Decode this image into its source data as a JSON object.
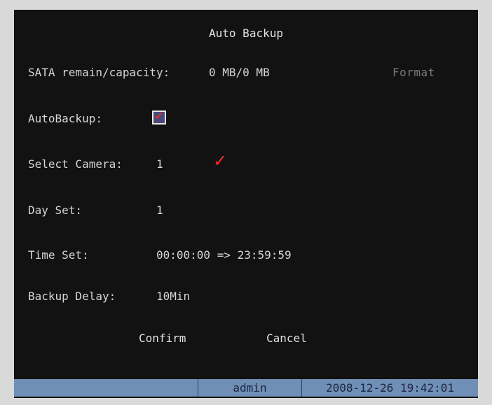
{
  "dialog": {
    "title": "Auto Backup",
    "format_label": "Format",
    "sata": {
      "label": "SATA remain/capacity:",
      "value": "0 MB/0 MB"
    },
    "autobackup": {
      "label": "AutoBackup:",
      "checked": true
    },
    "select_camera": {
      "label": "Select Camera:",
      "value": "1",
      "checked": true
    },
    "day_set": {
      "label": "Day Set:",
      "value": "1"
    },
    "time_set": {
      "label": "Time Set:",
      "value": "00:00:00 => 23:59:59"
    },
    "backup_delay": {
      "label": "Backup Delay:",
      "value": "10Min"
    },
    "confirm_label": "Confirm",
    "cancel_label": "Cancel"
  },
  "status_bar": {
    "user": "admin",
    "datetime": "2008-12-26 19:42:01"
  },
  "colors": {
    "background": "#121212",
    "text": "#d6d6d6",
    "disabled_text": "#7a7a7a",
    "check_red": "#ff2b2b",
    "status_bar": "#6f8fb6"
  },
  "check_glyph": "✓"
}
